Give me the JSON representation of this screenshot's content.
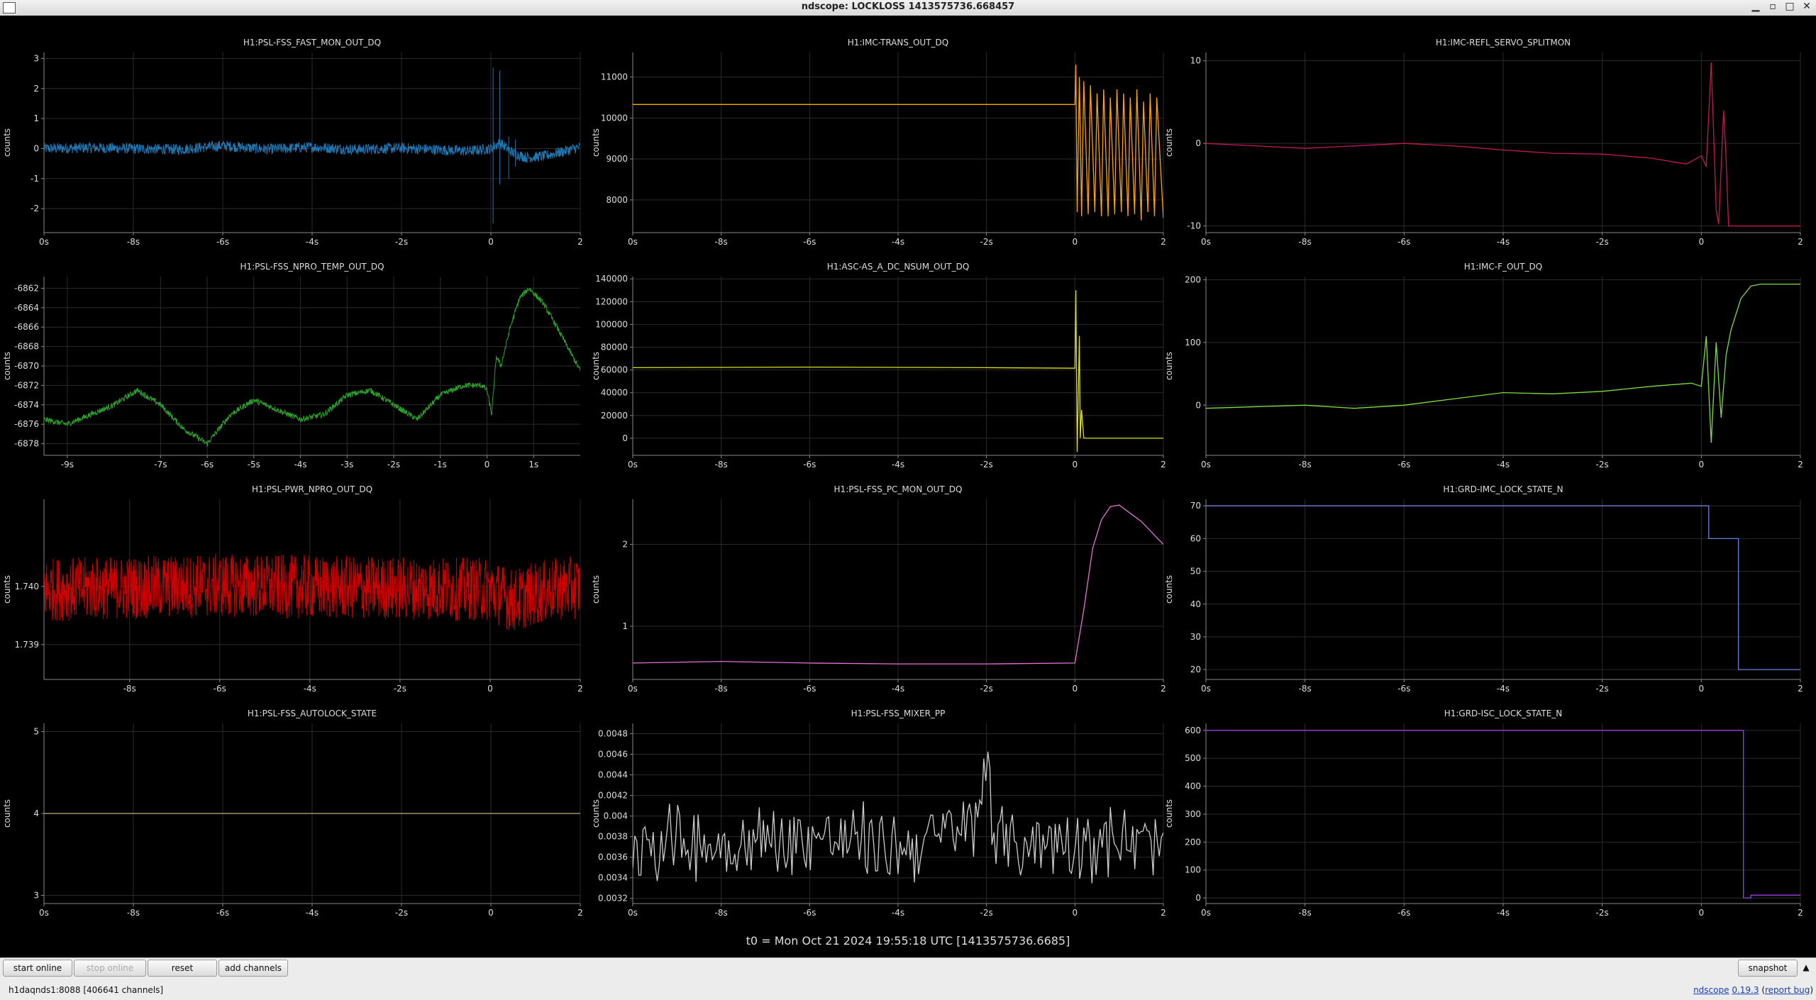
{
  "window": {
    "title": "ndscope: LOCKLOSS 1413575736.668457",
    "buttons": {
      "minimize": "▁",
      "restore": "▫",
      "maximize": "□",
      "close": "✕"
    }
  },
  "t0_label": "t0 = Mon Oct 21 2024 19:55:18 UTC [1413575736.6685]",
  "toolbar": {
    "start_online": "start online",
    "stop_online": "stop online",
    "reset": "reset",
    "add_channels": "add channels",
    "snapshot": "snapshot",
    "expand": "▲"
  },
  "status": {
    "server": "h1daqnds1:8088",
    "channels": "[406641 channels]",
    "app": "ndscope",
    "version": "0.19.3",
    "report": "report bug"
  },
  "chart_data": [
    {
      "type": "line",
      "title": "H1:PSL-FSS_FAST_MON_OUT_DQ",
      "ylabel": "counts",
      "color": "#1f77b4",
      "style": "noise",
      "xlim": [
        -10,
        2
      ],
      "ylim": [
        -2.8,
        3.2
      ],
      "xticks": [
        {
          "v": -10,
          "t": "0s"
        },
        {
          "v": -8,
          "t": "-8s"
        },
        {
          "v": -6,
          "t": "-6s"
        },
        {
          "v": -4,
          "t": "-4s"
        },
        {
          "v": -2,
          "t": "-2s"
        },
        {
          "v": 0,
          "t": "0"
        },
        {
          "v": 2,
          "t": "2"
        }
      ],
      "yticks": [
        {
          "v": -2,
          "t": "-2"
        },
        {
          "v": -1,
          "t": "-1"
        },
        {
          "v": 0,
          "t": "0"
        },
        {
          "v": 1,
          "t": "1"
        },
        {
          "v": 2,
          "t": "2"
        },
        {
          "v": 3,
          "t": "3"
        }
      ],
      "x": [
        -10,
        -9,
        -8,
        -7,
        -6,
        -5,
        -4,
        -3,
        -2,
        -1,
        -0.5,
        0,
        0.2,
        0.5,
        0.8,
        1.2,
        1.6,
        2
      ],
      "y": [
        0,
        0.03,
        0,
        -0.03,
        0.1,
        -0.02,
        0.05,
        -0.03,
        0.02,
        -0.05,
        -0.08,
        0,
        0.2,
        -0.15,
        -0.3,
        -0.25,
        -0.1,
        0.05
      ],
      "band": 0.18,
      "spikes": [
        {
          "x": 0.05,
          "y0": -2.5,
          "y1": 2.7
        },
        {
          "x": 0.2,
          "y0": -1.2,
          "y1": 2.6
        },
        {
          "x": 0.4,
          "y0": -1.0,
          "y1": 0.4
        },
        {
          "x": 0.55,
          "y0": -0.6,
          "y1": 0.3
        }
      ]
    },
    {
      "type": "line",
      "title": "H1:IMC-TRANS_OUT_DQ",
      "ylabel": "counts",
      "color": "#ffa500",
      "style": "line",
      "xlim": [
        -10,
        2
      ],
      "ylim": [
        7200,
        11600
      ],
      "xticks": [
        {
          "v": -10,
          "t": "0s"
        },
        {
          "v": -8,
          "t": "-8s"
        },
        {
          "v": -6,
          "t": "-6s"
        },
        {
          "v": -4,
          "t": "-4s"
        },
        {
          "v": -2,
          "t": "-2s"
        },
        {
          "v": 0,
          "t": "0"
        },
        {
          "v": 2,
          "t": "2"
        }
      ],
      "yticks": [
        {
          "v": 8000,
          "t": "8000"
        },
        {
          "v": 9000,
          "t": "9000"
        },
        {
          "v": 10000,
          "t": "10000"
        },
        {
          "v": 11000,
          "t": "11000"
        }
      ],
      "x": [
        -10,
        0,
        0.02,
        0.05,
        0.1,
        0.15,
        0.2,
        0.3,
        0.35,
        0.45,
        0.5,
        0.6,
        0.65,
        0.75,
        0.8,
        0.9,
        0.95,
        1.05,
        1.1,
        1.2,
        1.25,
        1.35,
        1.4,
        1.5,
        1.55,
        1.65,
        1.7,
        1.8,
        1.85,
        2
      ],
      "y": [
        10330,
        10330,
        11300,
        7700,
        11000,
        7600,
        10900,
        7650,
        10800,
        7700,
        10600,
        7600,
        10700,
        7600,
        10500,
        7650,
        10700,
        7700,
        10600,
        7600,
        10500,
        7650,
        10700,
        7500,
        10400,
        7700,
        10600,
        7600,
        10500,
        7550
      ],
      "band": 30
    },
    {
      "type": "line",
      "title": "H1:IMC-REFL_SERVO_SPLITMON",
      "ylabel": "counts",
      "color": "#c2185b",
      "style": "line",
      "xlim": [
        -10,
        2
      ],
      "ylim": [
        -10.8,
        11
      ],
      "xticks": [
        {
          "v": -10,
          "t": "0s"
        },
        {
          "v": -8,
          "t": "-8s"
        },
        {
          "v": -6,
          "t": "-6s"
        },
        {
          "v": -4,
          "t": "-4s"
        },
        {
          "v": -2,
          "t": "-2s"
        },
        {
          "v": 0,
          "t": "0"
        },
        {
          "v": 2,
          "t": "2"
        }
      ],
      "yticks": [
        {
          "v": -10,
          "t": "-10"
        },
        {
          "v": 0,
          "t": "0"
        },
        {
          "v": 10,
          "t": "10"
        }
      ],
      "x": [
        -10,
        -8,
        -6,
        -5,
        -4,
        -3,
        -2,
        -1,
        -0.3,
        0,
        0.1,
        0.2,
        0.3,
        0.35,
        0.45,
        0.5,
        0.55,
        0.6,
        2
      ],
      "y": [
        0,
        -0.6,
        0,
        -0.3,
        -0.8,
        -1.2,
        -1.3,
        -1.8,
        -2.5,
        -1.5,
        -2.8,
        9.8,
        -8.0,
        -9.8,
        4.0,
        -2,
        -10,
        -10,
        -10
      ]
    },
    {
      "type": "line",
      "title": "H1:PSL-FSS_NPRO_TEMP_OUT_DQ",
      "ylabel": "counts",
      "color": "#2ca02c",
      "style": "noise",
      "xlim": [
        -9.5,
        2
      ],
      "ylim": [
        -6879.2,
        -6860.8
      ],
      "xticks": [
        {
          "v": -9,
          "t": "-9s"
        },
        {
          "v": -7,
          "t": "-7s"
        },
        {
          "v": -6,
          "t": "-6s"
        },
        {
          "v": -5,
          "t": "-5s"
        },
        {
          "v": -4,
          "t": "-4s"
        },
        {
          "v": -3,
          "t": "-3s"
        },
        {
          "v": -2,
          "t": "-2s"
        },
        {
          "v": -1,
          "t": "-1s"
        },
        {
          "v": 0,
          "t": "0"
        },
        {
          "v": 1,
          "t": "1s"
        }
      ],
      "yticks": [
        {
          "v": -6878,
          "t": "-6878"
        },
        {
          "v": -6876,
          "t": "-6876"
        },
        {
          "v": -6874,
          "t": "-6874"
        },
        {
          "v": -6872,
          "t": "-6872"
        },
        {
          "v": -6870,
          "t": "-6870"
        },
        {
          "v": -6868,
          "t": "-6868"
        },
        {
          "v": -6866,
          "t": "-6866"
        },
        {
          "v": -6864,
          "t": "-6864"
        },
        {
          "v": -6862,
          "t": "-6862"
        }
      ],
      "x": [
        -9.5,
        -9,
        -8,
        -7.5,
        -7,
        -6.5,
        -6,
        -5.5,
        -5,
        -4.5,
        -4,
        -3.5,
        -3,
        -2.5,
        -2,
        -1.5,
        -1,
        -0.5,
        -0.1,
        0,
        0.1,
        0.2,
        0.3,
        0.5,
        0.7,
        0.9,
        1.2,
        1.5,
        2
      ],
      "y": [
        -6875.5,
        -6876,
        -6874,
        -6872.5,
        -6874,
        -6876.5,
        -6878,
        -6875,
        -6873.5,
        -6874.5,
        -6875.5,
        -6875,
        -6873,
        -6872.5,
        -6874,
        -6875.5,
        -6873,
        -6872,
        -6872,
        -6872.5,
        -6875,
        -6869,
        -6870,
        -6866,
        -6863,
        -6862,
        -6863.5,
        -6866,
        -6870.5
      ],
      "band": 0.3
    },
    {
      "type": "line",
      "title": "H1:ASC-AS_A_DC_NSUM_OUT_DQ",
      "ylabel": "counts",
      "color": "#dddd22",
      "style": "line",
      "xlim": [
        -10,
        2
      ],
      "ylim": [
        -15000,
        142000
      ],
      "xticks": [
        {
          "v": -10,
          "t": "0s"
        },
        {
          "v": -8,
          "t": "-8s"
        },
        {
          "v": -6,
          "t": "-6s"
        },
        {
          "v": -4,
          "t": "-4s"
        },
        {
          "v": -2,
          "t": "-2s"
        },
        {
          "v": 0,
          "t": "0"
        },
        {
          "v": 2,
          "t": "2"
        }
      ],
      "yticks": [
        {
          "v": 0,
          "t": "0"
        },
        {
          "v": 20000,
          "t": "20000"
        },
        {
          "v": 40000,
          "t": "40000"
        },
        {
          "v": 60000,
          "t": "60000"
        },
        {
          "v": 80000,
          "t": "80000"
        },
        {
          "v": 100000,
          "t": "100000"
        },
        {
          "v": 120000,
          "t": "120000"
        },
        {
          "v": 140000,
          "t": "140000"
        }
      ],
      "x": [
        -10,
        -6,
        -2,
        0,
        0.02,
        0.05,
        0.1,
        0.12,
        0.15,
        0.2,
        0.3,
        2
      ],
      "y": [
        62000,
        62500,
        62000,
        61500,
        130000,
        -12000,
        90000,
        0,
        25000,
        0,
        0,
        0
      ]
    },
    {
      "type": "line",
      "title": "H1:IMC-F_OUT_DQ",
      "ylabel": "counts",
      "color": "#7fdc3f",
      "style": "line",
      "xlim": [
        -10,
        2
      ],
      "ylim": [
        -80,
        205
      ],
      "xticks": [
        {
          "v": -10,
          "t": "0s"
        },
        {
          "v": -8,
          "t": "-8s"
        },
        {
          "v": -6,
          "t": "-6s"
        },
        {
          "v": -4,
          "t": "-4s"
        },
        {
          "v": -2,
          "t": "-2s"
        },
        {
          "v": 0,
          "t": "0"
        },
        {
          "v": 2,
          "t": "2"
        }
      ],
      "yticks": [
        {
          "v": 0,
          "t": "0"
        },
        {
          "v": 100,
          "t": "100"
        },
        {
          "v": 200,
          "t": "200"
        }
      ],
      "x": [
        -10,
        -8,
        -7,
        -6,
        -5,
        -4,
        -3,
        -2,
        -1,
        -0.2,
        0,
        0.1,
        0.2,
        0.3,
        0.4,
        0.5,
        0.6,
        0.8,
        1.0,
        1.2,
        2
      ],
      "y": [
        -5,
        0,
        -5,
        0,
        10,
        20,
        18,
        22,
        30,
        35,
        30,
        110,
        -60,
        100,
        -20,
        80,
        120,
        170,
        190,
        193,
        193
      ]
    },
    {
      "type": "line",
      "title": "H1:PSL-PWR_NPRO_OUT_DQ",
      "ylabel": "counts",
      "color": "#cc0000",
      "style": "noise",
      "xlim": [
        -9.9,
        2
      ],
      "ylim": [
        1.7384,
        1.7415
      ],
      "xticks": [
        {
          "v": -8,
          "t": "-8s"
        },
        {
          "v": -6,
          "t": "-6s"
        },
        {
          "v": -4,
          "t": "-4s"
        },
        {
          "v": -2,
          "t": "-2s"
        },
        {
          "v": 0,
          "t": "0"
        },
        {
          "v": 2,
          "t": "2"
        }
      ],
      "yticks": [
        {
          "v": 1.739,
          "t": "1.739"
        },
        {
          "v": 1.74,
          "t": "1.740"
        }
      ],
      "x": [
        -9.9,
        -8,
        -6,
        -4,
        -2,
        0,
        0.5,
        1,
        1.5,
        2
      ],
      "y": [
        1.73995,
        1.73998,
        1.74002,
        1.73999,
        1.73997,
        1.73995,
        1.73975,
        1.73988,
        1.73996,
        1.73998
      ],
      "band": 0.00055
    },
    {
      "type": "line",
      "title": "H1:PSL-FSS_PC_MON_OUT_DQ",
      "ylabel": "counts",
      "color": "#e76fd6",
      "style": "line",
      "xlim": [
        -10,
        2
      ],
      "ylim": [
        0.35,
        2.55
      ],
      "xticks": [
        {
          "v": -10,
          "t": "0s"
        },
        {
          "v": -8,
          "t": "-8s"
        },
        {
          "v": -6,
          "t": "-6s"
        },
        {
          "v": -4,
          "t": "-4s"
        },
        {
          "v": -2,
          "t": "-2s"
        },
        {
          "v": 0,
          "t": "0"
        },
        {
          "v": 2,
          "t": "2"
        }
      ],
      "yticks": [
        {
          "v": 1,
          "t": "1"
        },
        {
          "v": 2,
          "t": "2"
        }
      ],
      "x": [
        -10,
        -8,
        -6,
        -4,
        -2,
        0,
        0.2,
        0.4,
        0.6,
        0.8,
        1.0,
        1.2,
        1.5,
        2
      ],
      "y": [
        0.55,
        0.57,
        0.55,
        0.54,
        0.54,
        0.55,
        1.2,
        1.95,
        2.3,
        2.46,
        2.48,
        2.4,
        2.28,
        2.0
      ]
    },
    {
      "type": "line",
      "title": "H1:GRD-IMC_LOCK_STATE_N",
      "ylabel": "counts",
      "color": "#6a7fd9",
      "style": "step",
      "xlim": [
        -10,
        2
      ],
      "ylim": [
        17,
        72
      ],
      "xticks": [
        {
          "v": -10,
          "t": "0s"
        },
        {
          "v": -8,
          "t": "-8s"
        },
        {
          "v": -6,
          "t": "-6s"
        },
        {
          "v": -4,
          "t": "-4s"
        },
        {
          "v": -2,
          "t": "-2s"
        },
        {
          "v": 0,
          "t": "0"
        },
        {
          "v": 2,
          "t": "2"
        }
      ],
      "yticks": [
        {
          "v": 20,
          "t": "20"
        },
        {
          "v": 30,
          "t": "30"
        },
        {
          "v": 40,
          "t": "40"
        },
        {
          "v": 50,
          "t": "50"
        },
        {
          "v": 60,
          "t": "60"
        },
        {
          "v": 70,
          "t": "70"
        }
      ],
      "x": [
        -10,
        0.15,
        0.15,
        0.75,
        0.75,
        2
      ],
      "y": [
        70,
        70,
        60,
        60,
        20,
        20
      ]
    },
    {
      "type": "line",
      "title": "H1:PSL-FSS_AUTOLOCK_STATE",
      "ylabel": "counts",
      "color": "#c0b07a",
      "style": "line",
      "xlim": [
        -10,
        2
      ],
      "ylim": [
        2.9,
        5.1
      ],
      "xticks": [
        {
          "v": -10,
          "t": "0s"
        },
        {
          "v": -8,
          "t": "-8s"
        },
        {
          "v": -6,
          "t": "-6s"
        },
        {
          "v": -4,
          "t": "-4s"
        },
        {
          "v": -2,
          "t": "-2s"
        },
        {
          "v": 0,
          "t": "0"
        },
        {
          "v": 2,
          "t": "2"
        }
      ],
      "yticks": [
        {
          "v": 3,
          "t": "3"
        },
        {
          "v": 4,
          "t": "4"
        },
        {
          "v": 5,
          "t": "5"
        }
      ],
      "x": [
        -10,
        2
      ],
      "y": [
        4,
        4
      ]
    },
    {
      "type": "line",
      "title": "H1:PSL-FSS_MIXER_PP",
      "ylabel": "counts",
      "color": "#cccccc",
      "style": "jitter",
      "xlim": [
        -10,
        2
      ],
      "ylim": [
        0.00315,
        0.0049
      ],
      "xticks": [
        {
          "v": -10,
          "t": "0s"
        },
        {
          "v": -8,
          "t": "-8s"
        },
        {
          "v": -6,
          "t": "-6s"
        },
        {
          "v": -4,
          "t": "-4s"
        },
        {
          "v": -2,
          "t": "-2s"
        },
        {
          "v": 0,
          "t": "0"
        },
        {
          "v": 2,
          "t": "2"
        }
      ],
      "yticks": [
        {
          "v": 0.0032,
          "t": "0.0032"
        },
        {
          "v": 0.0034,
          "t": "0.0034"
        },
        {
          "v": 0.0036,
          "t": "0.0036"
        },
        {
          "v": 0.0038,
          "t": "0.0038"
        },
        {
          "v": 0.004,
          "t": "0.004"
        },
        {
          "v": 0.0042,
          "t": "0.0042"
        },
        {
          "v": 0.0044,
          "t": "0.0044"
        },
        {
          "v": 0.0046,
          "t": "0.0046"
        },
        {
          "v": 0.0048,
          "t": "0.0048"
        }
      ],
      "x": [
        -10,
        -8,
        -6,
        -4,
        -2.2,
        -2,
        -1.8,
        0,
        2
      ],
      "y": [
        0.0038,
        0.0037,
        0.0038,
        0.0037,
        0.0039,
        0.0048,
        0.0037,
        0.0038,
        0.0037
      ],
      "band": 0.00045
    },
    {
      "type": "line",
      "title": "H1:GRD-ISC_LOCK_STATE_N",
      "ylabel": "counts",
      "color": "#9b3fe0",
      "style": "step",
      "xlim": [
        -10,
        2
      ],
      "ylim": [
        -20,
        625
      ],
      "xticks": [
        {
          "v": -10,
          "t": "0s"
        },
        {
          "v": -8,
          "t": "-8s"
        },
        {
          "v": -6,
          "t": "-6s"
        },
        {
          "v": -4,
          "t": "-4s"
        },
        {
          "v": -2,
          "t": "-2s"
        },
        {
          "v": 0,
          "t": "0"
        },
        {
          "v": 2,
          "t": "2"
        }
      ],
      "yticks": [
        {
          "v": 0,
          "t": "0"
        },
        {
          "v": 100,
          "t": "100"
        },
        {
          "v": 200,
          "t": "200"
        },
        {
          "v": 300,
          "t": "300"
        },
        {
          "v": 400,
          "t": "400"
        },
        {
          "v": 500,
          "t": "500"
        },
        {
          "v": 600,
          "t": "600"
        }
      ],
      "x": [
        -10,
        0.85,
        0.85,
        1.0,
        1.0,
        2
      ],
      "y": [
        600,
        600,
        0,
        0,
        10,
        10
      ]
    }
  ]
}
